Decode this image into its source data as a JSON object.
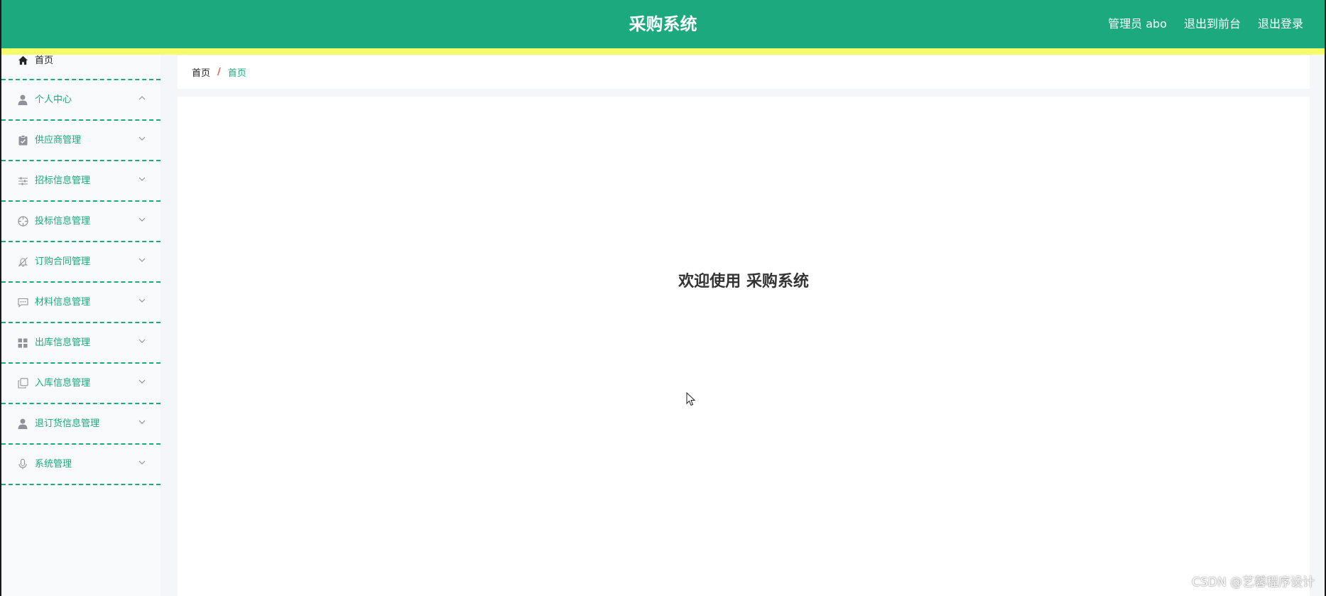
{
  "header": {
    "title": "采购系统",
    "user_label": "管理员 abo",
    "front_link": "退出到前台",
    "logout_link": "退出登录"
  },
  "sidebar": {
    "items": [
      {
        "label": "首页",
        "icon": "home-icon"
      },
      {
        "label": "个人中心",
        "icon": "user-icon",
        "expanded": true
      },
      {
        "label": "供应商管理",
        "icon": "clipboard-icon"
      },
      {
        "label": "招标信息管理",
        "icon": "sliders-icon"
      },
      {
        "label": "投标信息管理",
        "icon": "crosshair-icon"
      },
      {
        "label": "订购合同管理",
        "icon": "bell-off-icon"
      },
      {
        "label": "材料信息管理",
        "icon": "chat-icon"
      },
      {
        "label": "出库信息管理",
        "icon": "grid-icon"
      },
      {
        "label": "入库信息管理",
        "icon": "copy-icon"
      },
      {
        "label": "退订货信息管理",
        "icon": "person-icon"
      },
      {
        "label": "系统管理",
        "icon": "microphone-icon"
      }
    ]
  },
  "breadcrumb": {
    "home": "首页",
    "separator": "/",
    "current": "首页"
  },
  "main": {
    "welcome": "欢迎使用 采购系统"
  },
  "watermark": "CSDN @艺馨程序设计",
  "colors": {
    "primary": "#1ba97d",
    "accent_strip": "#f4fc6a",
    "separator": "#e0523c",
    "sidebar_bg": "#f9fafc",
    "page_bg": "#f5f6fa"
  }
}
